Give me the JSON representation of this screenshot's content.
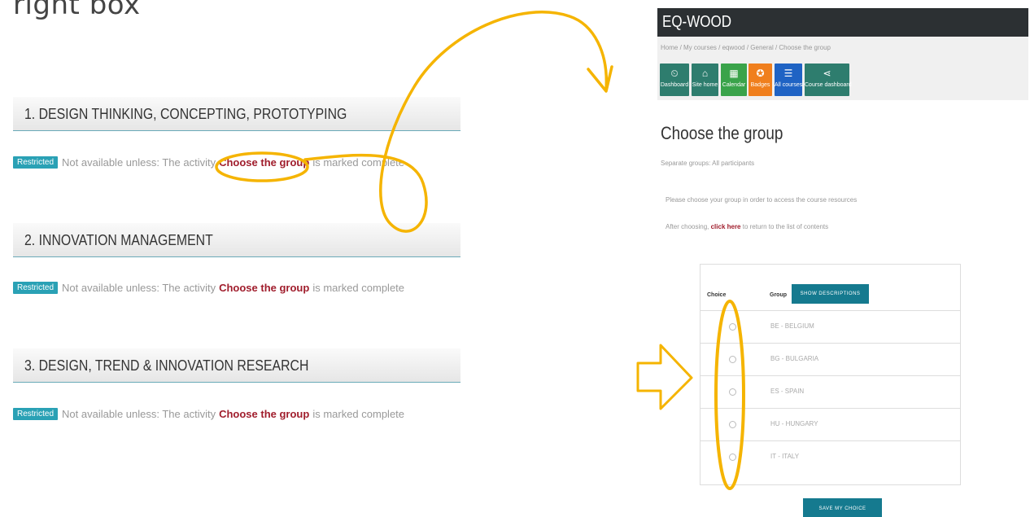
{
  "slide": {
    "heading": "right box"
  },
  "left": {
    "sections": [
      {
        "title": "1. DESIGN THINKING, CONCEPTING, PROTOTYPING",
        "badge": "Restricted",
        "text_before": "Not available unless: The activity",
        "link": "Choose the group",
        "text_after": "is marked complete"
      },
      {
        "title": "2. INNOVATION MANAGEMENT",
        "badge": "Restricted",
        "text_before": "Not available unless: The activity",
        "link": "Choose the group",
        "text_after": "is marked complete"
      },
      {
        "title": "3. DESIGN, TREND & INNOVATION RESEARCH",
        "badge": "Restricted",
        "text_before": "Not available unless: The activity",
        "link": "Choose the group",
        "text_after": "is marked complete"
      }
    ]
  },
  "right": {
    "site_title": "EQ-WOOD",
    "breadcrumb": "Home / My courses / eqwood / General / Choose the group",
    "nav": [
      {
        "label": "Dashboard",
        "icon": "dashboard-icon",
        "glyph": "⏲",
        "color": "#2e7d6e"
      },
      {
        "label": "Site home",
        "icon": "home-icon",
        "glyph": "⌂",
        "color": "#2e7d6e"
      },
      {
        "label": "Calendar",
        "icon": "calendar-icon",
        "glyph": "▦",
        "color": "#3aa34a"
      },
      {
        "label": "Badges",
        "icon": "badge-icon",
        "glyph": "✪",
        "color": "#f07f1d"
      },
      {
        "label": "All courses",
        "icon": "courses-icon",
        "glyph": "☰",
        "color": "#1f63c4"
      },
      {
        "label": "Course dashboard",
        "icon": "share-icon",
        "glyph": "⋖",
        "color": "#2e7d6e"
      }
    ],
    "page_title": "Choose the group",
    "group_mode": "Separate groups: All participants",
    "intro_line1": "Please choose your group in order to access the course resources",
    "intro_line2_before": "After choosing, ",
    "intro_line2_link": "click here",
    "intro_line2_after": " to return to the list of contents",
    "table": {
      "col_choice": "Choice",
      "col_group": "Group",
      "desc_button": "SHOW DESCRIPTIONS",
      "rows": [
        "BE - BELGIUM",
        "BG - BULGARIA",
        "ES - SPAIN",
        "HU - HUNGARY",
        "IT - ITALY"
      ]
    },
    "save_button": "SAVE MY CHOICE"
  },
  "annotation_color": "#f5b400"
}
